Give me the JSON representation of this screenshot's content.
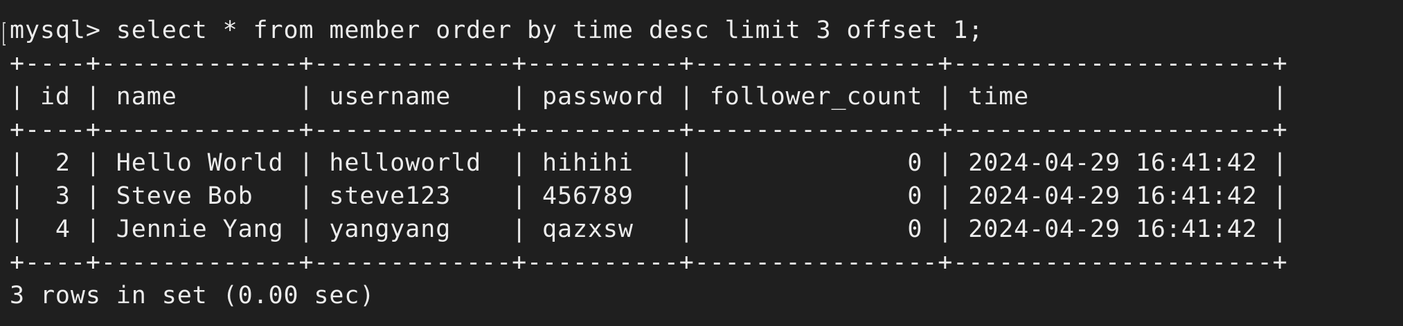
{
  "terminal": {
    "prompt": "mysql> ",
    "command": "select * from member order by time desc limit 3 offset 1;",
    "border": "+----+-------------+-------------+----------+----------------+---------------------+",
    "header": "| id | name        | username    | password | follower_count | time                |",
    "rows": [
      "|  2 | Hello World | helloworld  | hihihi   |              0 | 2024-04-29 16:41:42 |",
      "|  3 | Steve Bob   | steve123    | 456789   |              0 | 2024-04-29 16:41:42 |",
      "|  4 | Jennie Yang | yangyang    | qazxsw   |              0 | 2024-04-29 16:41:42 |"
    ],
    "status": "3 rows in set (0.00 sec)"
  },
  "colors": {
    "background": "#1f1f1f",
    "text": "#ececec"
  }
}
